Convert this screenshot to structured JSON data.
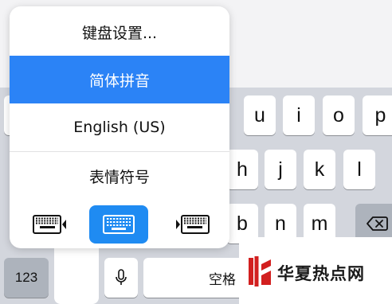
{
  "keyboard_menu": {
    "items": [
      {
        "label": "键盘设置..."
      },
      {
        "label": "简体拼音",
        "selected": true
      },
      {
        "label": "English (US)"
      },
      {
        "label": "表情符号"
      }
    ],
    "layout_modes": [
      {
        "icon": "keyboard-left-icon"
      },
      {
        "icon": "keyboard-full-icon",
        "selected": true
      },
      {
        "icon": "keyboard-right-icon"
      }
    ]
  },
  "keyboard": {
    "row1": [
      "u",
      "i",
      "o",
      "p"
    ],
    "row2": [
      "h",
      "j",
      "k",
      "l"
    ],
    "row3": [
      "b",
      "n",
      "m"
    ],
    "numbers_label": "123",
    "space_label": "空格",
    "delete_icon": "backspace-icon",
    "mic_icon": "microphone-icon"
  },
  "colors": {
    "accent": "#2b83f6",
    "keyboard_bg": "#d3d6dd",
    "key_bg": "#ffffff",
    "function_key_bg": "#adb3bc"
  },
  "watermark": {
    "text": "华夏热点网"
  }
}
